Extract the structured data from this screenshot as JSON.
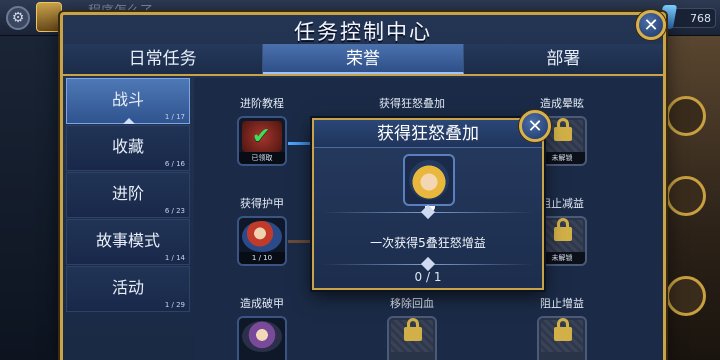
{
  "window": {
    "title": "任务控制中心",
    "background_title": "程序怎么了"
  },
  "topbar": {
    "gem_count": "768"
  },
  "tabs": [
    {
      "label": "日常任务",
      "active": false
    },
    {
      "label": "荣誉",
      "active": true
    },
    {
      "label": "部署",
      "active": false
    }
  ],
  "sidenav": [
    {
      "label": "战斗",
      "count": "1 / 17",
      "active": true
    },
    {
      "label": "收藏",
      "count": "6 / 16",
      "active": false
    },
    {
      "label": "进阶",
      "count": "6 / 23",
      "active": false
    },
    {
      "label": "故事模式",
      "count": "1 / 14",
      "active": false
    },
    {
      "label": "活动",
      "count": "1 / 29",
      "active": false
    }
  ],
  "tasks": {
    "r1c1": {
      "label": "进阶教程",
      "caption": "已领取",
      "icon": "check-icon"
    },
    "r1c2": {
      "label": "获得狂怒叠加"
    },
    "r1c3": {
      "label": "造成晕眩",
      "caption": "未解锁",
      "icon": "lock-icon"
    },
    "r2c1": {
      "label": "获得护甲",
      "caption": "1 / 10",
      "icon": "hero-portrait"
    },
    "r2c3": {
      "label": "阻止减益",
      "caption": "未解锁",
      "icon": "lock-icon"
    },
    "r3c1": {
      "label": "造成破甲",
      "icon": "hero-portrait"
    },
    "r3c2": {
      "label": "移除回血",
      "icon": "lock-icon"
    },
    "r3c3": {
      "label": "阻止增益",
      "icon": "lock-icon"
    }
  },
  "popup": {
    "title": "获得狂怒叠加",
    "description": "一次获得5叠狂怒增益",
    "progress": "0 / 1"
  },
  "colors": {
    "gold_border": "#c9a347",
    "active_tab": "#4a71ad",
    "panel_bg": "#233553"
  }
}
